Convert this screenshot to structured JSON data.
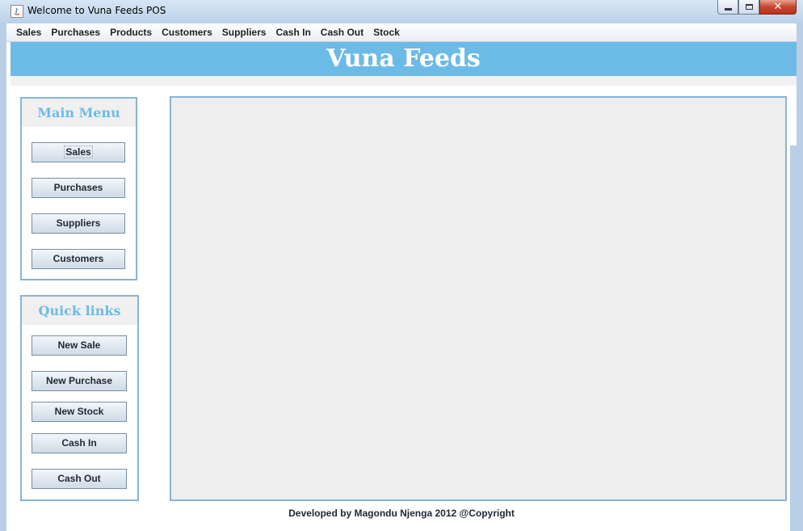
{
  "window": {
    "title": "Welcome to Vuna Feeds POS",
    "close_glyph": "✕"
  },
  "menubar": {
    "items": [
      "Sales",
      "Purchases",
      "Products",
      "Customers",
      "Suppliers",
      "Cash In",
      "Cash Out",
      "Stock"
    ]
  },
  "banner": {
    "title": "Vuna Feeds",
    "color": "#6cbbe7"
  },
  "main_menu": {
    "heading": "Main Menu",
    "buttons": [
      "Sales",
      "Purchases",
      "Suppliers",
      "Customers"
    ]
  },
  "quick_links": {
    "heading": "Quick links",
    "buttons": [
      "New Sale",
      "New Purchase",
      "New Stock",
      "Cash In",
      "Cash Out"
    ]
  },
  "footer": {
    "text": "Developed by Magondu Njenga 2012 @Copyright"
  },
  "colors": {
    "accent": "#6cbbe7",
    "panel_border": "#8ab3d3",
    "content_bg": "#eeeeee"
  }
}
